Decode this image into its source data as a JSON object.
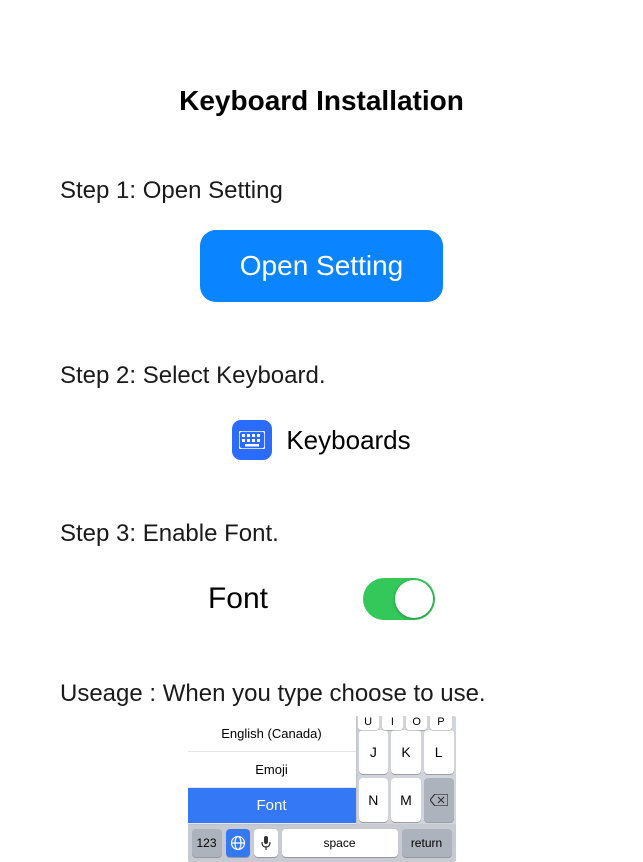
{
  "title": "Keyboard Installation",
  "steps": {
    "step1": {
      "label": "Step 1: Open Setting",
      "button_label": "Open Setting"
    },
    "step2": {
      "label": "Step 2: Select Keyboard.",
      "keyboards_label": "Keyboards"
    },
    "step3": {
      "label": "Step 3: Enable Font.",
      "font_label": "Font",
      "toggle_on": true
    },
    "usage": {
      "label": "Useage : When you type choose to use."
    }
  },
  "keyboard_preview": {
    "menu": {
      "item1": "English (Canada)",
      "item2": "Emoji",
      "item3": "Font"
    },
    "top_strip": [
      "U",
      "I",
      "O",
      "P"
    ],
    "row2": [
      "J",
      "K",
      "L"
    ],
    "row3": [
      "N",
      "M"
    ],
    "bottom": {
      "num_key": "123",
      "space": "space",
      "return": "return"
    }
  }
}
